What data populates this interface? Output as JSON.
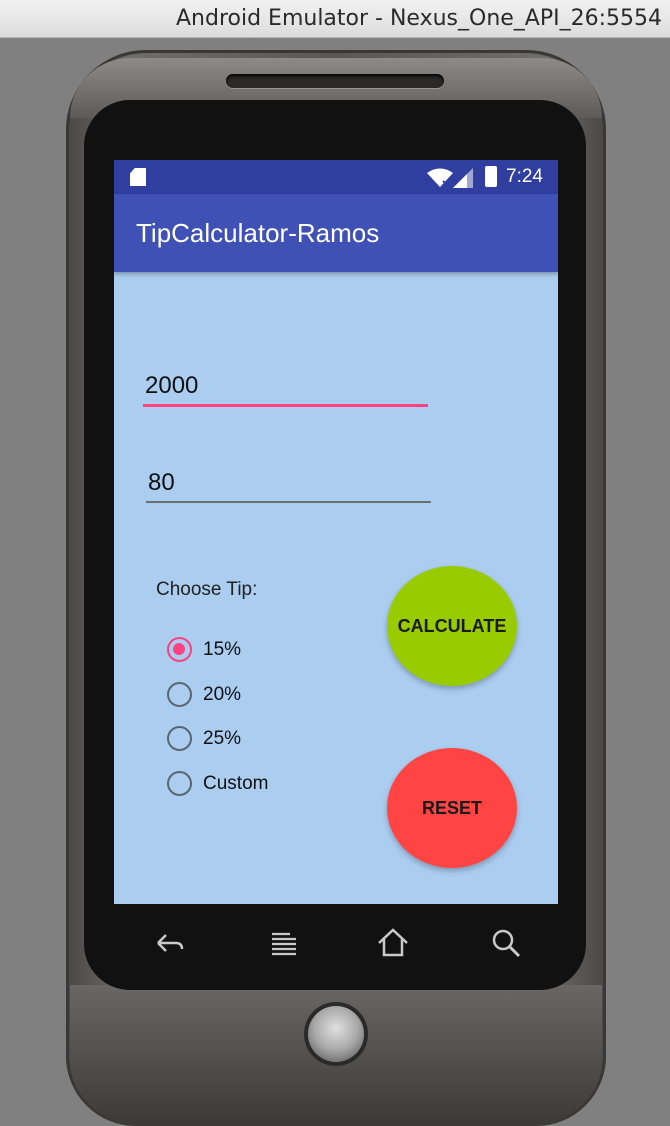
{
  "window": {
    "title": "Android Emulator - Nexus_One_API_26:5554"
  },
  "status_bar": {
    "time": "7:24"
  },
  "app_bar": {
    "title": "TipCalculator-Ramos"
  },
  "form": {
    "bill_amount": "2000",
    "second_value": "80",
    "choose_tip_label": "Choose Tip:",
    "tip_options": [
      {
        "label": "15%",
        "checked": true
      },
      {
        "label": "20%",
        "checked": false
      },
      {
        "label": "25%",
        "checked": false
      },
      {
        "label": "Custom",
        "checked": false
      }
    ],
    "calculate_label": "CALCULATE",
    "reset_label": "RESET"
  },
  "colors": {
    "status_bar": "#303f9f",
    "app_bar": "#3f51b5",
    "screen_background": "#abcdf0",
    "accent": "#ff4081",
    "calculate_button": "#99cc00",
    "reset_button": "#ff4444"
  },
  "hardware_keys": [
    "back-icon",
    "menu-icon",
    "home-icon",
    "search-icon"
  ]
}
